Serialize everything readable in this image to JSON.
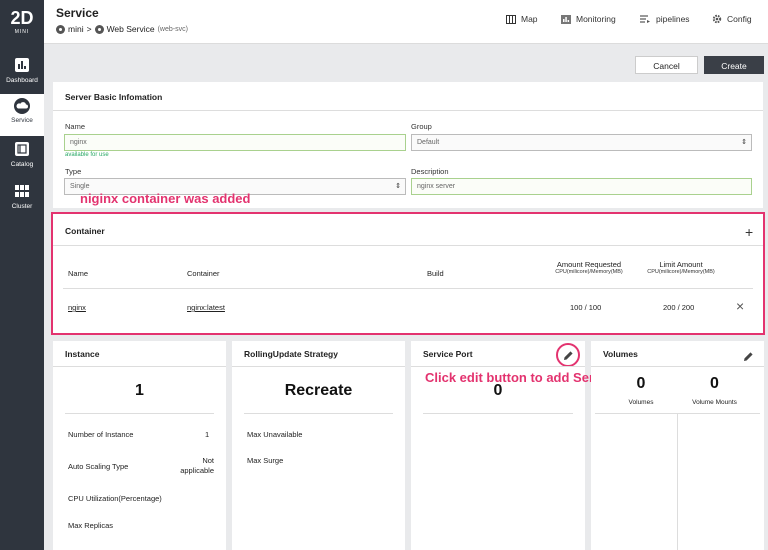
{
  "brand": {
    "mark": "2D",
    "text": "MINI"
  },
  "sidebar": {
    "items": [
      {
        "label": "Dashboard",
        "icon": "dashboard-icon"
      },
      {
        "label": "Service",
        "icon": "cloud-icon"
      },
      {
        "label": "Catalog",
        "icon": "catalog-icon"
      },
      {
        "label": "Cluster",
        "icon": "cluster-icon"
      }
    ]
  },
  "header": {
    "title": "Service",
    "breadcrumb": {
      "root": "mini",
      "sep": ">",
      "current": "Web Service",
      "current_sub": "(web-svc)"
    },
    "nav": [
      {
        "label": "Map",
        "icon": "map-icon"
      },
      {
        "label": "Monitoring",
        "icon": "monitoring-icon"
      },
      {
        "label": "pipelines",
        "icon": "pipelines-icon"
      },
      {
        "label": "Config",
        "icon": "gear-icon"
      }
    ]
  },
  "actions": {
    "cancel": "Cancel",
    "create": "Create"
  },
  "basic": {
    "title": "Server Basic Infomation",
    "name_label": "Name",
    "name_value": "nginx",
    "name_hint": "available for use",
    "group_label": "Group",
    "group_value": "Default",
    "type_label": "Type",
    "type_value": "Single",
    "desc_label": "Description",
    "desc_value": "nginx server"
  },
  "annotations": {
    "container_added": "niginx container was added",
    "edit_hint": "Click edit button to add Service port"
  },
  "container": {
    "title": "Container",
    "add_symbol": "+",
    "headers": {
      "name": "Name",
      "container": "Container",
      "build": "Build",
      "requested": "Amount Requested",
      "requested_sub": "CPU(milicore)/Memory(MB)",
      "limit": "Limit Amount",
      "limit_sub": "CPU(milicore)/Memory(MB)"
    },
    "rows": [
      {
        "name": "nginx",
        "container": "nginx:latest",
        "build": "",
        "requested": "100 / 100",
        "limit": "200 / 200",
        "remove": "×"
      }
    ]
  },
  "instance": {
    "title": "Instance",
    "count": "1",
    "rows": [
      {
        "label": "Number of Instance",
        "value": "1"
      },
      {
        "label": "Auto Scaling Type",
        "value": "Not applicable"
      },
      {
        "label": "CPU Utilization(Percentage)",
        "value": ""
      },
      {
        "label": "Max Replicas",
        "value": ""
      }
    ]
  },
  "rolling": {
    "title": "RollingUpdate Strategy",
    "value": "Recreate",
    "rows": [
      {
        "label": "Max Unavailable"
      },
      {
        "label": "Max Surge"
      }
    ]
  },
  "ports": {
    "title": "Service Port",
    "count": "0"
  },
  "volumes": {
    "title": "Volumes",
    "volumes_count": "0",
    "volumes_label": "Volumes",
    "mounts_count": "0",
    "mounts_label": "Volume Mounts"
  },
  "colors": {
    "sidebar": "#2f353e",
    "create_btn": "#3a3f47",
    "accent_pink": "#e3336f",
    "valid_green": "#a9d18e"
  }
}
